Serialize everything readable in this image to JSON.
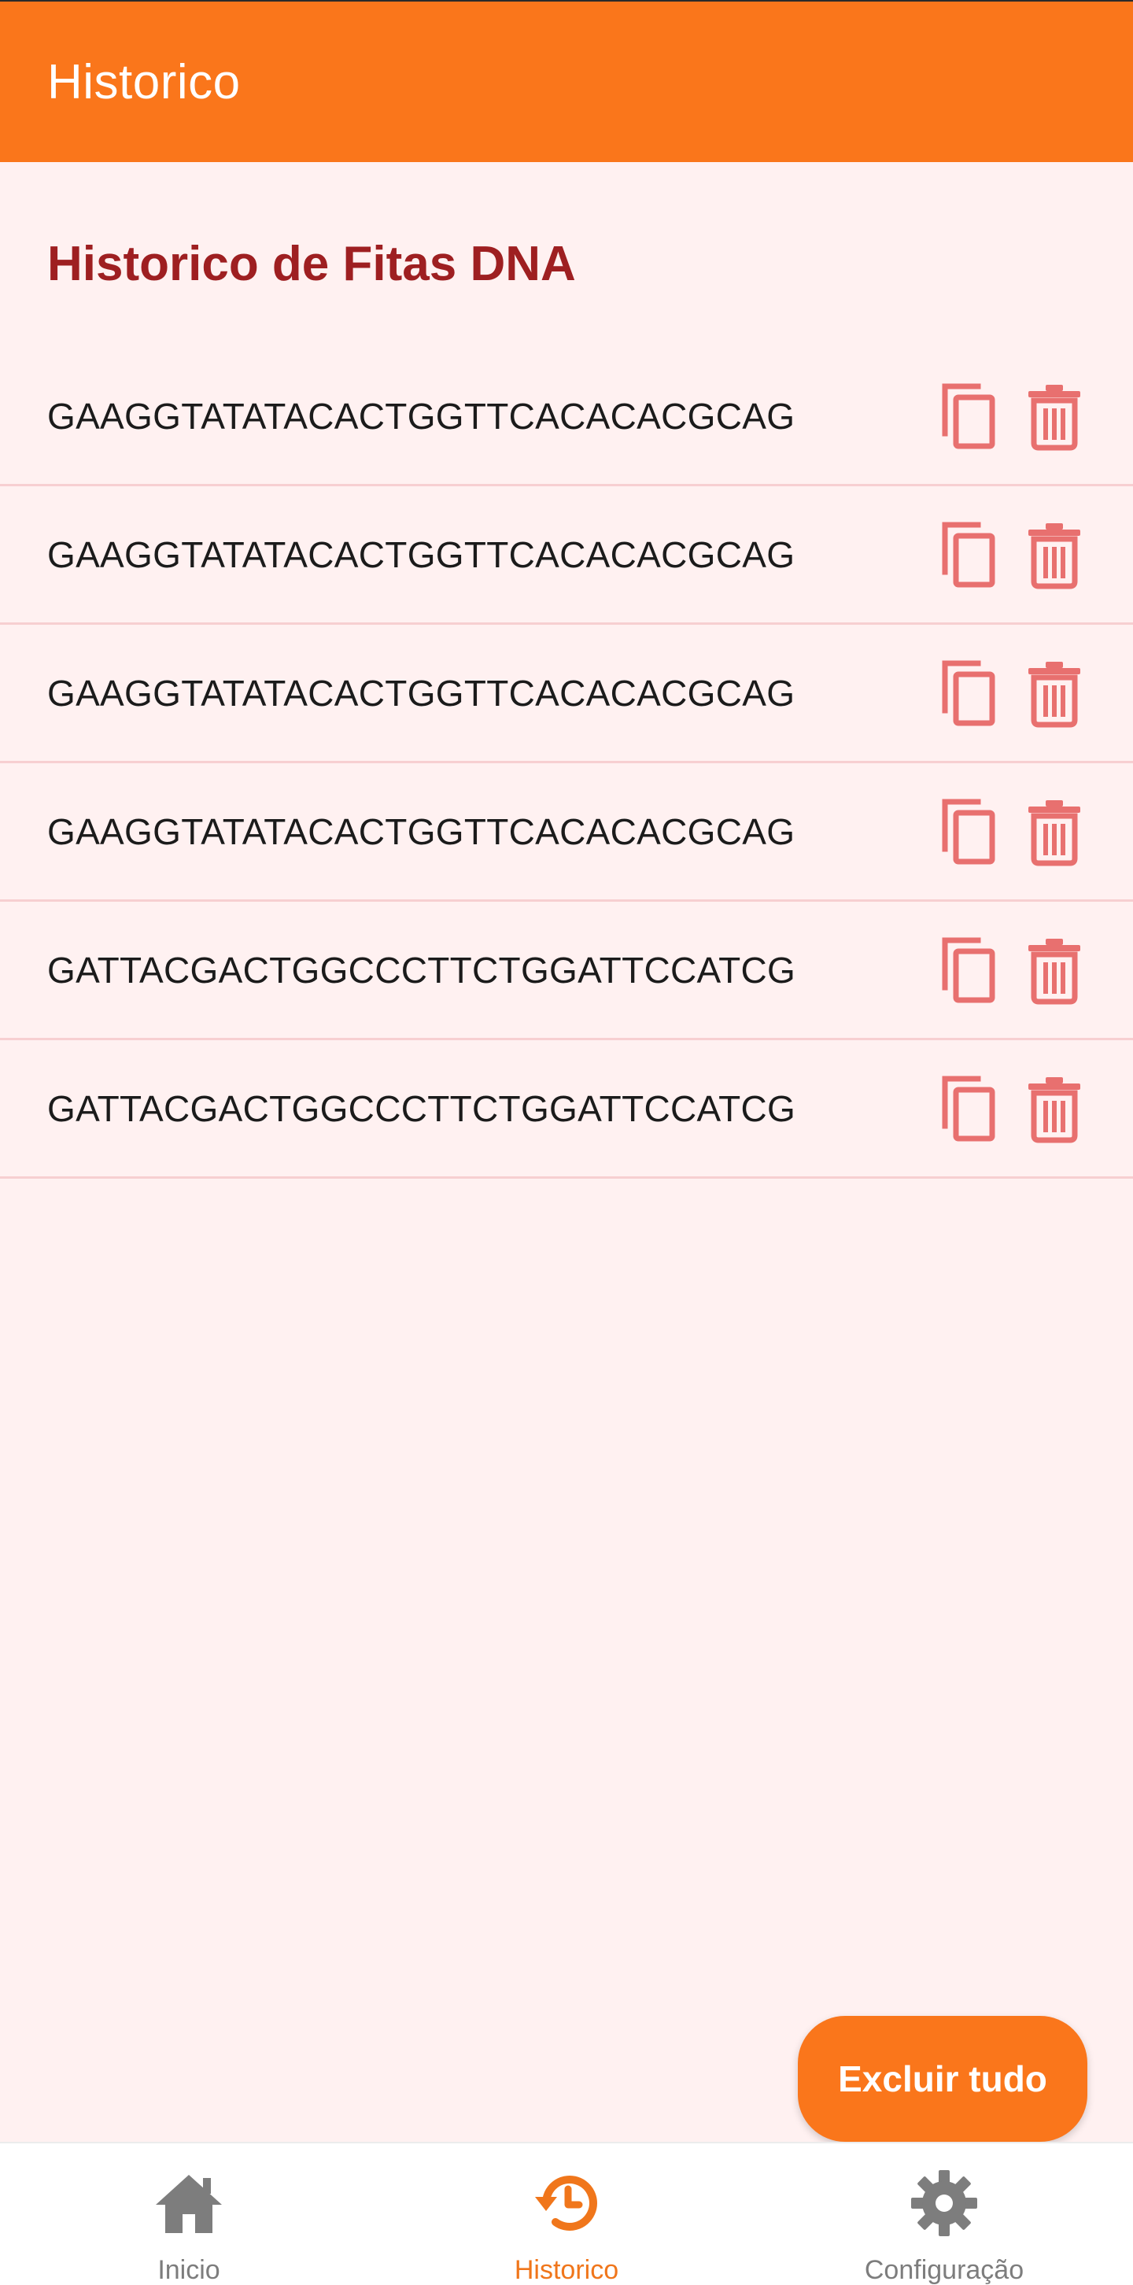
{
  "app_bar": {
    "title": "Historico"
  },
  "section": {
    "title": "Historico de Fitas DNA"
  },
  "history_items": [
    {
      "sequence": "GAAGGTATATACACTGGTTCACACACGCAG"
    },
    {
      "sequence": "GAAGGTATATACACTGGTTCACACACGCAG"
    },
    {
      "sequence": "GAAGGTATATACACTGGTTCACACACGCAG"
    },
    {
      "sequence": "GAAGGTATATACACTGGTTCACACACGCAG"
    },
    {
      "sequence": "GATTACGACTGGCCCTTCTGGATTCCATCG"
    },
    {
      "sequence": "GATTACGACTGGCCCTTCTGGATTCCATCG"
    }
  ],
  "item_actions": {
    "copy_icon": "copy-icon",
    "delete_icon": "trash-icon"
  },
  "fab": {
    "label": "Excluir tudo"
  },
  "bottom_nav": {
    "items": [
      {
        "label": "Inicio",
        "icon": "home-icon",
        "active": false
      },
      {
        "label": "Historico",
        "icon": "history-icon",
        "active": true
      },
      {
        "label": "Configuração",
        "icon": "gear-icon",
        "active": false
      }
    ]
  },
  "colors": {
    "accent": "#fa761b",
    "title_red": "#9e1f21",
    "icon_red": "#e8706f",
    "background": "#fff1f1",
    "nav_inactive": "#7d7d7d"
  }
}
